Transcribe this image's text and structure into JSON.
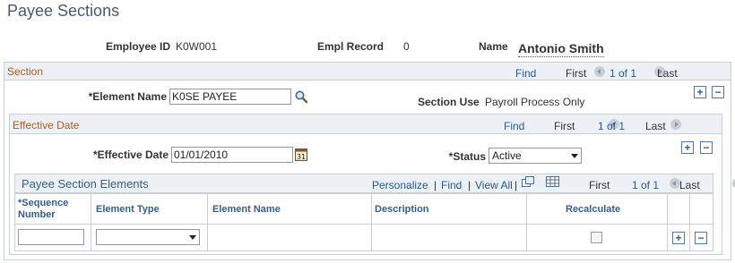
{
  "page": {
    "title": "Payee Sections"
  },
  "header": {
    "employee_id_label": "Employee ID",
    "employee_id": "K0W001",
    "empl_record_label": "Empl Record",
    "empl_record": "0",
    "name_label": "Name",
    "name": "Antonio Smith"
  },
  "section": {
    "title": "Section",
    "find": "Find",
    "first": "First",
    "count": "1 of 1",
    "last": "Last",
    "element_name_label": "*Element Name",
    "element_name_value": "K0SE PAYEE",
    "section_use_label": "Section Use",
    "section_use_value": "Payroll Process Only",
    "add": "+",
    "remove": "−"
  },
  "effective": {
    "title": "Effective Date",
    "find": "Find",
    "first": "First",
    "count": "1 of 1",
    "last": "Last",
    "date_label": "*Effective Date",
    "date_value": "01/01/2010",
    "calendar_glyph": "31",
    "status_label": "*Status",
    "status_value": "Active",
    "add": "+",
    "remove": "−"
  },
  "elements": {
    "title": "Payee Section Elements",
    "personalize": "Personalize",
    "sep1": "|",
    "find": "Find",
    "sep2": "|",
    "view_all": "View All",
    "sep3": "|",
    "first": "First",
    "count": "1 of 1",
    "last": "Last",
    "columns": {
      "seq_line1": "*Sequence",
      "seq_line2": "Number",
      "element_type": "Element Type",
      "element_name": "Element Name",
      "description": "Description",
      "recalculate": "Recalculate"
    },
    "row": {
      "sequence": "",
      "element_type": "",
      "recalculate": false
    },
    "add": "+",
    "remove": "−"
  }
}
